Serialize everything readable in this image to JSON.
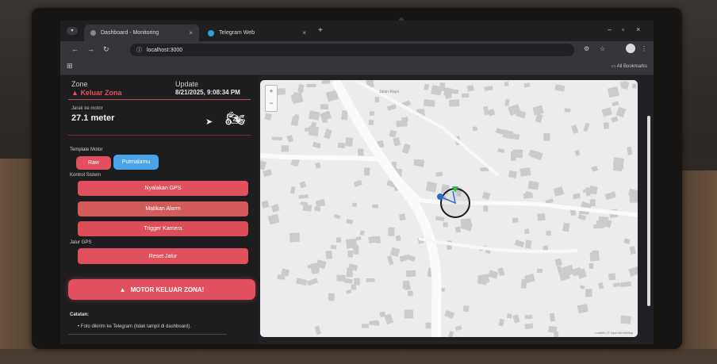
{
  "browser": {
    "tabs": [
      {
        "label": "Dashboard - Monitoring",
        "active": true
      },
      {
        "label": "Telegram Web",
        "active": false
      }
    ],
    "url": "localhost:3000",
    "all_bookmarks": "All Bookmarks"
  },
  "dashboard": {
    "zone_label": "Zone",
    "zone_value": "Keluar Zona",
    "update_label": "Update",
    "update_value": "8/21/2025, 9:08:34 PM",
    "distance_label": "Jarak ke motor",
    "distance_value": "27.1 meter",
    "template_label": "Template Motor",
    "template_buttons": [
      "Raw",
      "Putmalamu"
    ],
    "control_label": "Kontrol Sistem",
    "control_buttons": [
      "Nyalakan GPS",
      "Matikan Alarm",
      "Trigger Kamera"
    ],
    "gps_label": "Jalur GPS",
    "reset_button": "Reset Jalur",
    "alert_text": "MOTOR KELUAR ZONA!",
    "notes_label": "Catatan:",
    "notes_items": [
      "Foto dikirim ke Telegram (tidak tampil di dashboard)."
    ]
  },
  "map": {
    "zoom_in": "+",
    "zoom_out": "−",
    "street_label": "Jalan Raya",
    "attribution": "Leaflet | © OpenStreetMap"
  },
  "colors": {
    "accent_red": "#e2505e",
    "accent_blue": "#4aa3e8",
    "zone_circle": "#1c1c1c"
  }
}
